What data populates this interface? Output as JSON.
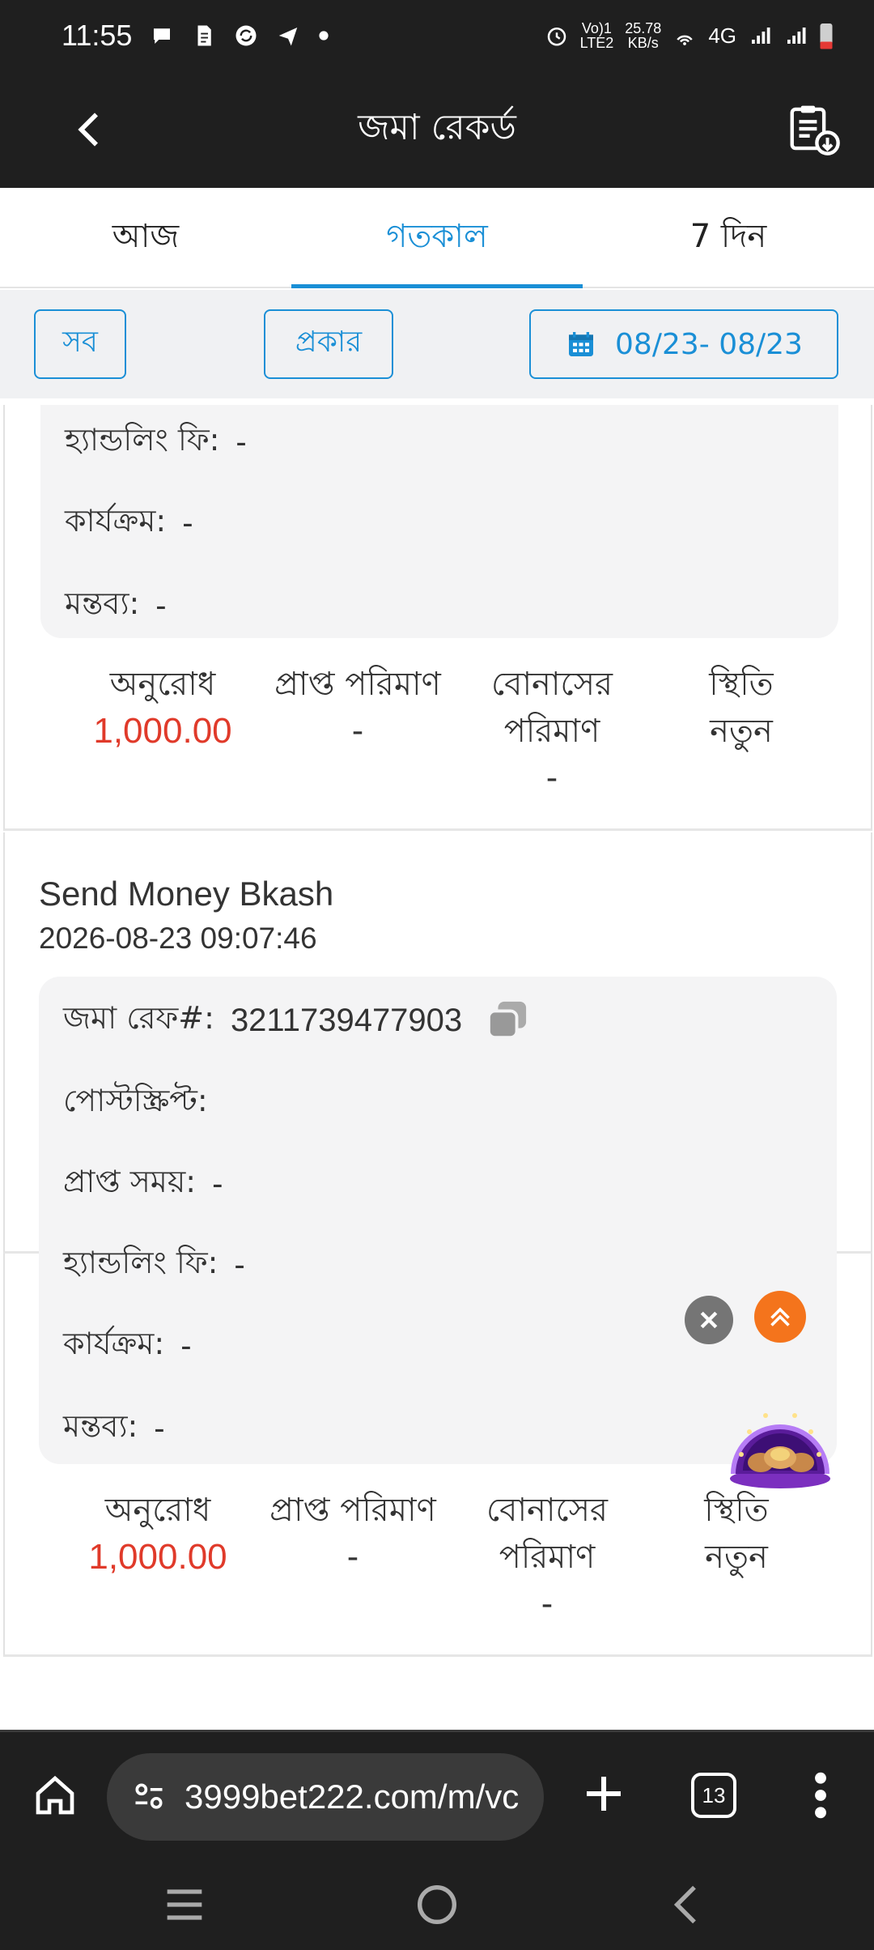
{
  "statusbar": {
    "time": "11:55",
    "volte": "Vo) 1\nLTE2",
    "speed_value": "25.78",
    "speed_unit": "KB/s",
    "network": "4G"
  },
  "header": {
    "title": "জমা রেকর্ড"
  },
  "tabs": [
    {
      "label": "আজ",
      "active": false
    },
    {
      "label": "গতকাল",
      "active": true
    },
    {
      "label": "7 দিন",
      "active": false
    }
  ],
  "filters": {
    "all_label": "সব",
    "type_label": "প্রকার",
    "date_range": "08/23- 08/23"
  },
  "records": [
    {
      "handling_fee_label": "হ্যান্ডলিং ফি:",
      "handling_fee_value": "-",
      "activity_label": "কার্যক্রম:",
      "activity_value": "-",
      "remark_label": "মন্তব্য:",
      "remark_value": "-",
      "summary": {
        "request_label": "অনুরোধ",
        "request_value": "1,000.00",
        "received_label": "প্রাপ্ত পরিমাণ",
        "received_value": "-",
        "bonus_label_1": "বোনাসের",
        "bonus_label_2": "পরিমাণ",
        "bonus_value": "-",
        "status_label": "স্থিতি",
        "status_value": "নতুন"
      }
    },
    {
      "title": "Send Money Bkash",
      "timestamp": "2026-08-23 09:07:46",
      "ref_label": "জমা রেফ#:",
      "ref_value": "3211739477903",
      "postscript_label": "পোস্টস্ক্রিপ্ট:",
      "received_time_label": "প্রাপ্ত সময়:",
      "received_time_value": "-",
      "handling_fee_label": "হ্যান্ডলিং ফি:",
      "handling_fee_value": "-",
      "activity_label": "কার্যক্রম:",
      "activity_value": "-",
      "remark_label": "মন্তব্য:",
      "remark_value": "-",
      "summary": {
        "request_label": "অনুরোধ",
        "request_value": "1,000.00",
        "received_label": "প্রাপ্ত পরিমাণ",
        "received_value": "-",
        "bonus_label_1": "বোনাসের",
        "bonus_label_2": "পরিমাণ",
        "bonus_value": "-",
        "status_label": "স্থিতি",
        "status_value": "নতুন"
      }
    }
  ],
  "browser": {
    "url": "3999bet222.com/m/vc",
    "tab_count": "13"
  },
  "colors": {
    "accent": "#1a8fd6",
    "amount_red": "#e03a2a",
    "dark_bar": "#1f1f1f",
    "scroll_top_orange": "#f4741c"
  },
  "icons": [
    "chat-icon",
    "document-icon",
    "sync-icon",
    "send-icon",
    "alarm-icon",
    "hotspot-icon",
    "signal-icon",
    "battery-icon",
    "back-arrow-icon",
    "clipboard-download-icon",
    "calendar-icon",
    "copy-icon",
    "close-icon",
    "scroll-top-icon",
    "home-icon",
    "site-info-icon",
    "plus-icon",
    "tab-switcher-icon",
    "more-menu-icon",
    "recent-apps-icon",
    "home-circle-icon",
    "nav-back-icon"
  ]
}
